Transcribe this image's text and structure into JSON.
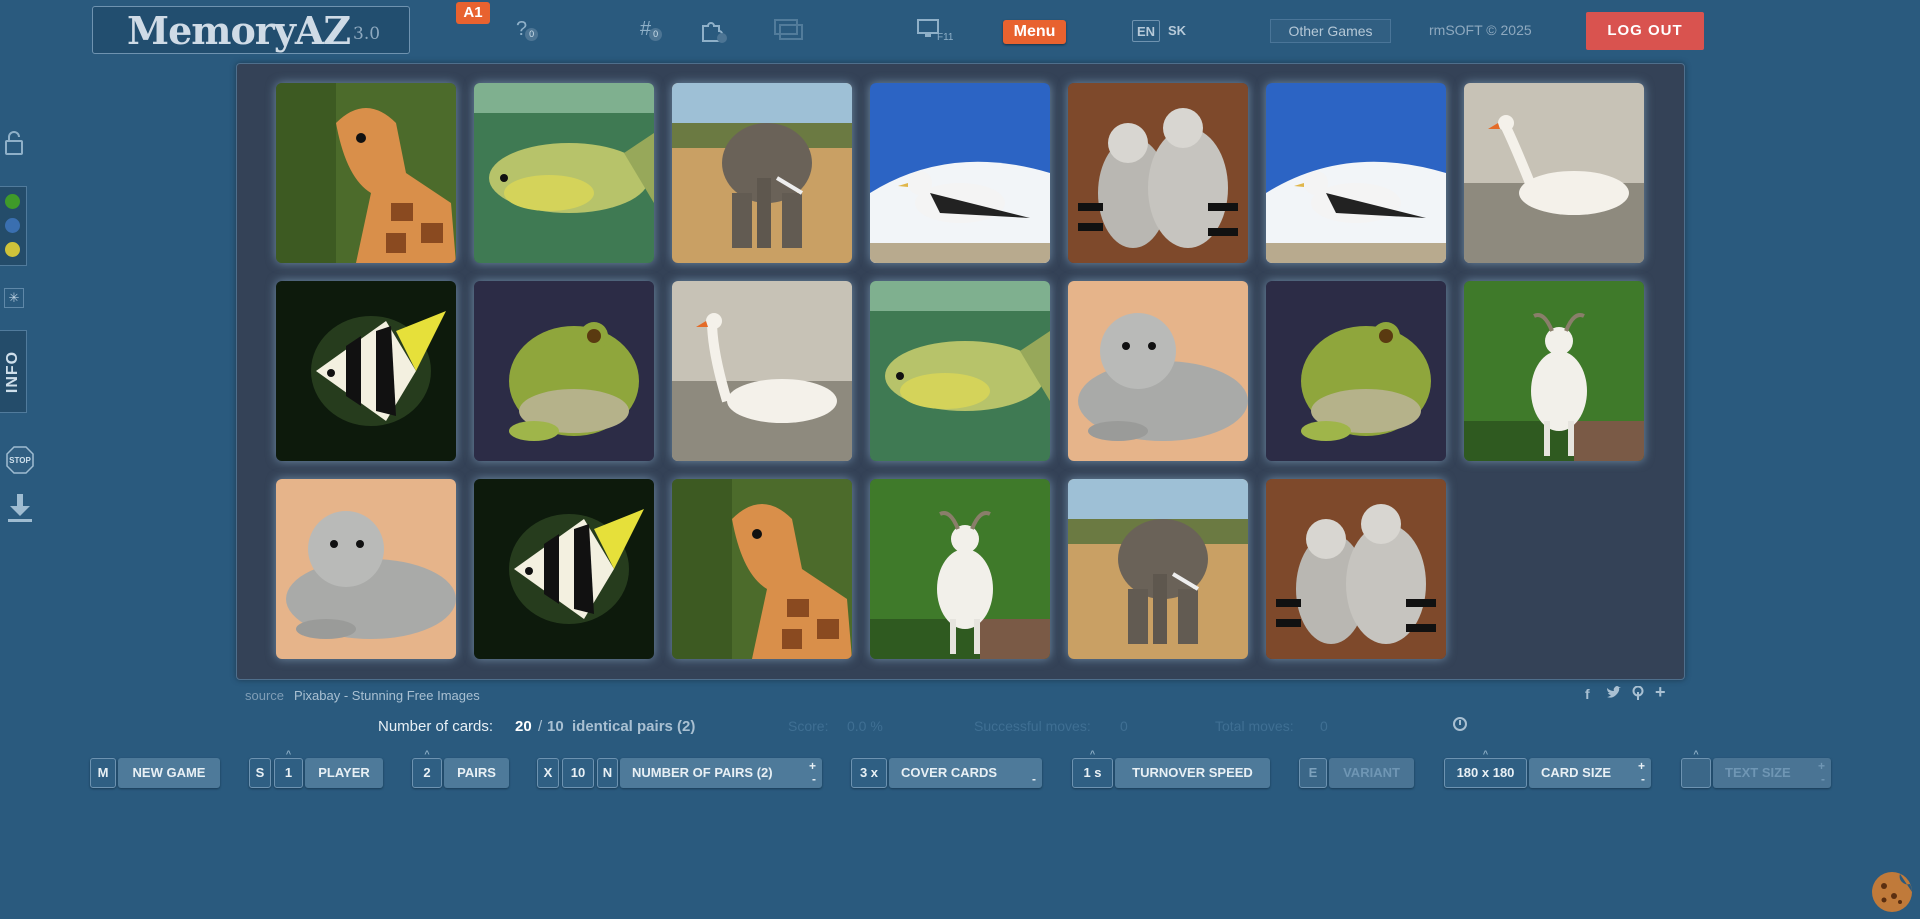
{
  "header": {
    "logo_text": "MemoryAZ",
    "logo_version": "3.0",
    "level_badge": "A1",
    "help_icon_sub": "0",
    "hash_icon_sub": "0",
    "fullscreen_key": "F11",
    "menu_label": "Menu",
    "lang_en": "EN",
    "lang_sk": "SK",
    "other_games": "Other Games",
    "copyright": "rmSOFT © 2025",
    "logout": "LOG OUT"
  },
  "sidebar": {
    "colors": [
      "#3f9a2a",
      "#3a6fb0",
      "#cfc23a"
    ],
    "info_label": "INFO",
    "stop_label": "STOP"
  },
  "board": {
    "cards": [
      "giraffe",
      "carp",
      "elephant",
      "seagull",
      "lemurs",
      "seagull",
      "swan",
      "angelfish",
      "frog",
      "swan",
      "carp",
      "seal",
      "frog",
      "goat",
      "seal",
      "angelfish",
      "giraffe",
      "goat",
      "elephant",
      "lemurs"
    ]
  },
  "footer": {
    "source_label": "source",
    "source_value": "Pixabay - Stunning Free Images",
    "cards_label": "Number of cards:",
    "cards_count": "20",
    "cards_slash": "/",
    "pairs_count": "10",
    "identical_pairs": "identical pairs (2)",
    "score_label": "Score:",
    "score_value": "0.0 %",
    "successful_label": "Successful moves:",
    "successful_value": "0",
    "total_label": "Total moves:",
    "total_value": "0"
  },
  "controls": {
    "new_game_key": "M",
    "new_game": "NEW GAME",
    "player_key": "S",
    "player_count": "1",
    "player": "PLAYER",
    "pairs_count": "2",
    "pairs": "PAIRS",
    "nop_key_x": "X",
    "nop_value": "10",
    "nop_key_n": "N",
    "number_of_pairs": "NUMBER OF PAIRS (2)",
    "cover_value": "3 x",
    "cover_cards": "COVER CARDS",
    "speed_value": "1 s",
    "turnover_speed": "TURNOVER SPEED",
    "variant_key": "E",
    "variant": "VARIANT",
    "size_value": "180 x 180",
    "card_size": "CARD SIZE",
    "text_size": "TEXT SIZE"
  }
}
